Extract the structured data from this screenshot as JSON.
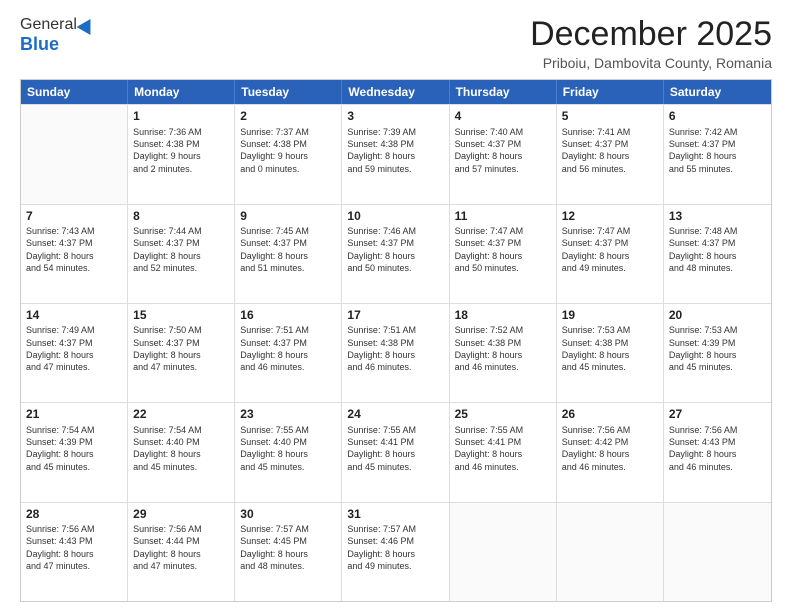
{
  "header": {
    "logo_general": "General",
    "logo_blue": "Blue",
    "month_title": "December 2025",
    "subtitle": "Priboiu, Dambovita County, Romania"
  },
  "weekdays": [
    "Sunday",
    "Monday",
    "Tuesday",
    "Wednesday",
    "Thursday",
    "Friday",
    "Saturday"
  ],
  "rows": [
    [
      {
        "day": "",
        "lines": []
      },
      {
        "day": "1",
        "lines": [
          "Sunrise: 7:36 AM",
          "Sunset: 4:38 PM",
          "Daylight: 9 hours",
          "and 2 minutes."
        ]
      },
      {
        "day": "2",
        "lines": [
          "Sunrise: 7:37 AM",
          "Sunset: 4:38 PM",
          "Daylight: 9 hours",
          "and 0 minutes."
        ]
      },
      {
        "day": "3",
        "lines": [
          "Sunrise: 7:39 AM",
          "Sunset: 4:38 PM",
          "Daylight: 8 hours",
          "and 59 minutes."
        ]
      },
      {
        "day": "4",
        "lines": [
          "Sunrise: 7:40 AM",
          "Sunset: 4:37 PM",
          "Daylight: 8 hours",
          "and 57 minutes."
        ]
      },
      {
        "day": "5",
        "lines": [
          "Sunrise: 7:41 AM",
          "Sunset: 4:37 PM",
          "Daylight: 8 hours",
          "and 56 minutes."
        ]
      },
      {
        "day": "6",
        "lines": [
          "Sunrise: 7:42 AM",
          "Sunset: 4:37 PM",
          "Daylight: 8 hours",
          "and 55 minutes."
        ]
      }
    ],
    [
      {
        "day": "7",
        "lines": [
          "Sunrise: 7:43 AM",
          "Sunset: 4:37 PM",
          "Daylight: 8 hours",
          "and 54 minutes."
        ]
      },
      {
        "day": "8",
        "lines": [
          "Sunrise: 7:44 AM",
          "Sunset: 4:37 PM",
          "Daylight: 8 hours",
          "and 52 minutes."
        ]
      },
      {
        "day": "9",
        "lines": [
          "Sunrise: 7:45 AM",
          "Sunset: 4:37 PM",
          "Daylight: 8 hours",
          "and 51 minutes."
        ]
      },
      {
        "day": "10",
        "lines": [
          "Sunrise: 7:46 AM",
          "Sunset: 4:37 PM",
          "Daylight: 8 hours",
          "and 50 minutes."
        ]
      },
      {
        "day": "11",
        "lines": [
          "Sunrise: 7:47 AM",
          "Sunset: 4:37 PM",
          "Daylight: 8 hours",
          "and 50 minutes."
        ]
      },
      {
        "day": "12",
        "lines": [
          "Sunrise: 7:47 AM",
          "Sunset: 4:37 PM",
          "Daylight: 8 hours",
          "and 49 minutes."
        ]
      },
      {
        "day": "13",
        "lines": [
          "Sunrise: 7:48 AM",
          "Sunset: 4:37 PM",
          "Daylight: 8 hours",
          "and 48 minutes."
        ]
      }
    ],
    [
      {
        "day": "14",
        "lines": [
          "Sunrise: 7:49 AM",
          "Sunset: 4:37 PM",
          "Daylight: 8 hours",
          "and 47 minutes."
        ]
      },
      {
        "day": "15",
        "lines": [
          "Sunrise: 7:50 AM",
          "Sunset: 4:37 PM",
          "Daylight: 8 hours",
          "and 47 minutes."
        ]
      },
      {
        "day": "16",
        "lines": [
          "Sunrise: 7:51 AM",
          "Sunset: 4:37 PM",
          "Daylight: 8 hours",
          "and 46 minutes."
        ]
      },
      {
        "day": "17",
        "lines": [
          "Sunrise: 7:51 AM",
          "Sunset: 4:38 PM",
          "Daylight: 8 hours",
          "and 46 minutes."
        ]
      },
      {
        "day": "18",
        "lines": [
          "Sunrise: 7:52 AM",
          "Sunset: 4:38 PM",
          "Daylight: 8 hours",
          "and 46 minutes."
        ]
      },
      {
        "day": "19",
        "lines": [
          "Sunrise: 7:53 AM",
          "Sunset: 4:38 PM",
          "Daylight: 8 hours",
          "and 45 minutes."
        ]
      },
      {
        "day": "20",
        "lines": [
          "Sunrise: 7:53 AM",
          "Sunset: 4:39 PM",
          "Daylight: 8 hours",
          "and 45 minutes."
        ]
      }
    ],
    [
      {
        "day": "21",
        "lines": [
          "Sunrise: 7:54 AM",
          "Sunset: 4:39 PM",
          "Daylight: 8 hours",
          "and 45 minutes."
        ]
      },
      {
        "day": "22",
        "lines": [
          "Sunrise: 7:54 AM",
          "Sunset: 4:40 PM",
          "Daylight: 8 hours",
          "and 45 minutes."
        ]
      },
      {
        "day": "23",
        "lines": [
          "Sunrise: 7:55 AM",
          "Sunset: 4:40 PM",
          "Daylight: 8 hours",
          "and 45 minutes."
        ]
      },
      {
        "day": "24",
        "lines": [
          "Sunrise: 7:55 AM",
          "Sunset: 4:41 PM",
          "Daylight: 8 hours",
          "and 45 minutes."
        ]
      },
      {
        "day": "25",
        "lines": [
          "Sunrise: 7:55 AM",
          "Sunset: 4:41 PM",
          "Daylight: 8 hours",
          "and 46 minutes."
        ]
      },
      {
        "day": "26",
        "lines": [
          "Sunrise: 7:56 AM",
          "Sunset: 4:42 PM",
          "Daylight: 8 hours",
          "and 46 minutes."
        ]
      },
      {
        "day": "27",
        "lines": [
          "Sunrise: 7:56 AM",
          "Sunset: 4:43 PM",
          "Daylight: 8 hours",
          "and 46 minutes."
        ]
      }
    ],
    [
      {
        "day": "28",
        "lines": [
          "Sunrise: 7:56 AM",
          "Sunset: 4:43 PM",
          "Daylight: 8 hours",
          "and 47 minutes."
        ]
      },
      {
        "day": "29",
        "lines": [
          "Sunrise: 7:56 AM",
          "Sunset: 4:44 PM",
          "Daylight: 8 hours",
          "and 47 minutes."
        ]
      },
      {
        "day": "30",
        "lines": [
          "Sunrise: 7:57 AM",
          "Sunset: 4:45 PM",
          "Daylight: 8 hours",
          "and 48 minutes."
        ]
      },
      {
        "day": "31",
        "lines": [
          "Sunrise: 7:57 AM",
          "Sunset: 4:46 PM",
          "Daylight: 8 hours",
          "and 49 minutes."
        ]
      },
      {
        "day": "",
        "lines": []
      },
      {
        "day": "",
        "lines": []
      },
      {
        "day": "",
        "lines": []
      }
    ]
  ]
}
